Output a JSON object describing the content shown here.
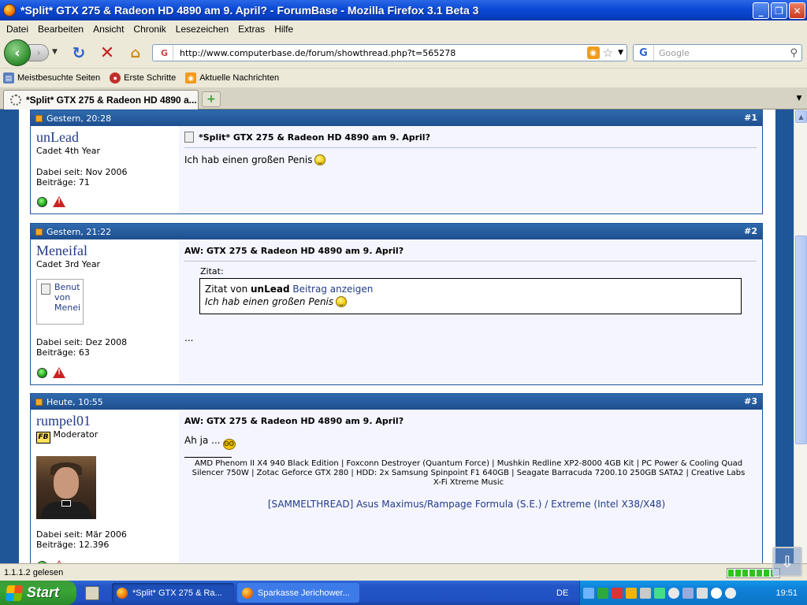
{
  "window": {
    "title": "*Split* GTX 275 & Radeon HD 4890 am 9. April? - ForumBase - Mozilla Firefox 3.1 Beta 3"
  },
  "menu": [
    "Datei",
    "Bearbeiten",
    "Ansicht",
    "Chronik",
    "Lesezeichen",
    "Extras",
    "Hilfe"
  ],
  "nav": {
    "url": "http://www.computerbase.de/forum/showthread.php?t=565278",
    "search_placeholder": "Google"
  },
  "bookmarks": [
    "Meistbesuchte Seiten",
    "Erste Schritte",
    "Aktuelle Nachrichten"
  ],
  "tabs": [
    {
      "label": "*Split* GTX 275 & Radeon HD 4890 a..."
    }
  ],
  "posts": [
    {
      "date": "Gestern, 20:28",
      "number": "#1",
      "user": "unLead",
      "rank": "Cadet 4th Year",
      "joined": "Dabei seit: Nov 2006",
      "count": "Beiträge: 71",
      "title": "*Split* GTX 275 & Radeon HD 4890 am 9. April?",
      "text": "Ich hab einen großen Penis"
    },
    {
      "date": "Gestern, 21:22",
      "number": "#2",
      "user": "Meneifal",
      "rank": "Cadet 3rd Year",
      "avatar_text": "Benut von Menei",
      "joined": "Dabei seit: Dez 2008",
      "count": "Beiträge: 63",
      "title": "AW: GTX 275 & Radeon HD 4890 am 9. April?",
      "quote_label": "Zitat:",
      "quote_prefix": "Zitat von",
      "quote_author": "unLead",
      "quote_link": "Beitrag anzeigen",
      "quote_text": "Ich hab einen großen Penis",
      "text": "..."
    },
    {
      "date": "Heute, 10:55",
      "number": "#3",
      "user": "rumpel01",
      "rank": "Moderator",
      "badge": "FB",
      "joined": "Dabei seit: Mär 2006",
      "count": "Beiträge: 12.396",
      "title": "AW: GTX 275 & Radeon HD 4890 am 9. April?",
      "text": "Ah ja ...",
      "signature": "AMD Phenom II X4 940 Black Edition | Foxconn Destroyer (Quantum Force) | Mushkin Redline XP2-8000 4GB Kit | PC Power & Cooling Quad Silencer 750W | Zotac Geforce GTX 280 | HDD: 2x Samsung Spinpoint F1 640GB | Seagate Barracuda 7200.10 250GB SATA2 | Creative Labs X-Fi Xtreme Music",
      "sig_link": "[SAMMELTHREAD] Asus Maximus/Rampage Formula (S.E.) / Extreme (Intel X38/X48)"
    }
  ],
  "status": {
    "text": "1.1.1.2 gelesen"
  },
  "taskbar": {
    "start": "Start",
    "tasks": [
      "*Split* GTX 275 & Ra...",
      "Sparkasse Jerichower..."
    ],
    "lang": "DE",
    "clock": "19:51"
  }
}
